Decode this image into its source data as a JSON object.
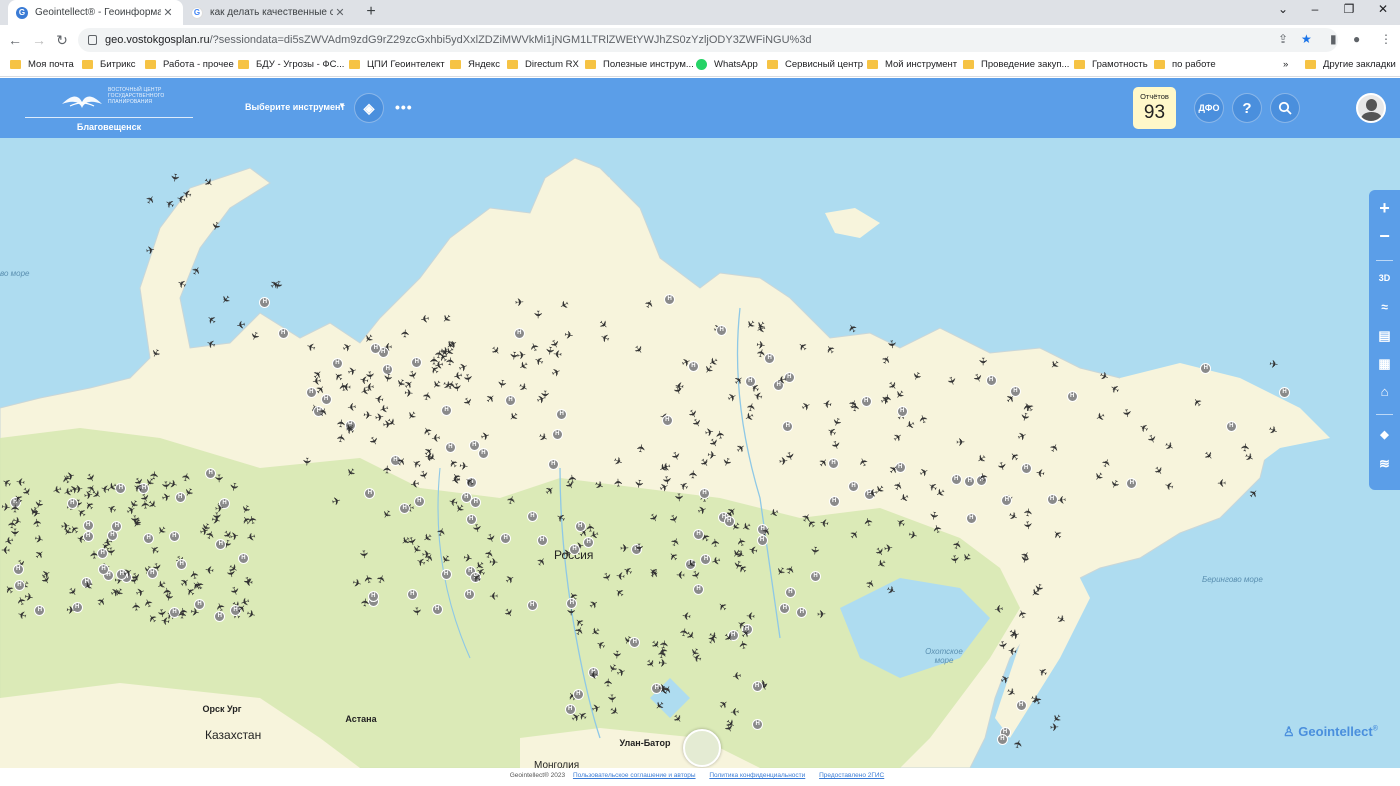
{
  "browser": {
    "tabs": [
      {
        "title": "Geointellect® - Геоинформаци",
        "active": true,
        "icon": "geointellect-favicon"
      },
      {
        "title": "как делать качественные сним",
        "active": false,
        "icon": "google-favicon"
      }
    ],
    "new_tab": "+",
    "window_controls": {
      "minimize": "–",
      "restore": "❐",
      "close": "✕",
      "tabsearch": "⌄"
    },
    "url_host": "geo.vostokgosplan.ru",
    "url_rest": "/?sessiondata=di5sZWVAdm9zdG9rZ29zcGxhbi5ydXxlZDZiMWVkMi1jNGM1LTRlZWEtYWJhZS0zYzljODY3ZWFiNGU%3d",
    "bookmarks": [
      {
        "label": "Моя почта",
        "type": "folder"
      },
      {
        "label": "Битрикс",
        "type": "folder"
      },
      {
        "label": "Работа - прочее",
        "type": "folder"
      },
      {
        "label": "БДУ - Угрозы - ФС...",
        "type": "folder"
      },
      {
        "label": "ЦПИ Геоинтелект",
        "type": "folder"
      },
      {
        "label": "Яндекс",
        "type": "folder"
      },
      {
        "label": "Directum RX",
        "type": "folder"
      },
      {
        "label": "Полезные инструм...",
        "type": "folder"
      },
      {
        "label": "WhatsApp",
        "type": "whatsapp"
      },
      {
        "label": "Сервисный центр",
        "type": "folder"
      },
      {
        "label": "Мой инструмент",
        "type": "folder"
      },
      {
        "label": "Проведение закуп...",
        "type": "folder"
      },
      {
        "label": "Грамотность",
        "type": "folder"
      },
      {
        "label": "по работе",
        "type": "folder"
      }
    ],
    "bookmarks_more": "»",
    "other_bookmarks": "Другие закладки"
  },
  "app": {
    "logo_text": "ВОСТОЧНЫЙ ЦЕНТР ГОСУДАРСТВЕННОГО ПЛАНИРОВАНИЯ",
    "city": "Благовещенск",
    "tool_select": "Выберите инструмент",
    "tool_caret": "▼",
    "more": "•••",
    "reports_label": "Отчётов",
    "reports_count": "93",
    "dfo": "ДФО",
    "help": "?",
    "search_icon": "search-icon"
  },
  "map": {
    "labels": {
      "sea_west": "во море",
      "russia": "Россия",
      "kazakhstan": "Казахстан",
      "astana": "Астана",
      "ulanbator": "Улан-Батор",
      "mongolia": "Монголия",
      "okhotsk": "Охотское море",
      "bering": "Берингово море",
      "orsk": "Орск Ург"
    },
    "side_tools": [
      "+",
      "−",
      "3D",
      "≈",
      "▤",
      "▦",
      "⌂",
      "◆",
      "≋"
    ],
    "brand": "Geointellect",
    "brand_mark": "®"
  },
  "footer": {
    "copyright": "Geointellect® 2023",
    "terms": "Пользовательское соглашение и авторы",
    "privacy": "Политика конфиденциальности",
    "provided": "Предоставлено 2ГИС"
  },
  "colors": {
    "header_blue": "#5b9ee8",
    "sea": "#aedcf0",
    "land": "#f7f4dc",
    "forest": "#d6e8b0"
  }
}
